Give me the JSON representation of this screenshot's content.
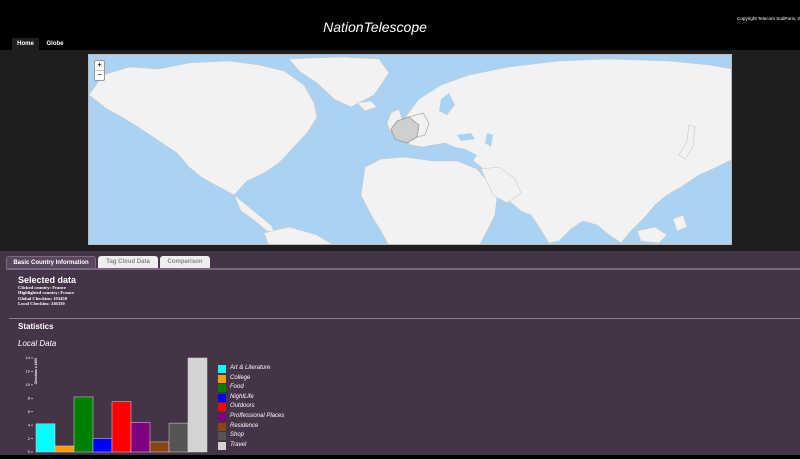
{
  "header": {
    "title": "NationTelescope",
    "copyright": "Copyright Telecom SudParis, 2"
  },
  "nav": {
    "home": "Home",
    "globe": "Globe"
  },
  "map": {
    "zoom_in": "+",
    "zoom_out": "−",
    "ocean_color": "#aad3f3",
    "land_color": "#f2f2f2",
    "highlight_color": "#cfcfcf"
  },
  "tabs": {
    "basic": "Basic Country Information",
    "tagcloud": "Tag Cloud Data",
    "comparison": "Comparison"
  },
  "selected": {
    "heading": "Selected data",
    "clicked": "Clicked country: France",
    "highlighted": "Highlighted country: France",
    "global_checkins": "Global Checkins: 193450",
    "local_checkins": "Local Checkins: 246350"
  },
  "statistics": {
    "heading": "Statistics",
    "subheading": "Local Data"
  },
  "chart_data": {
    "type": "bar",
    "ylabel": "Checkins x 1000",
    "ylim": [
      0,
      14
    ],
    "yticks": [
      "0",
      "2",
      "4",
      "6",
      "8",
      "10",
      "12",
      "14"
    ],
    "categories": [
      "Art & Literature",
      "College",
      "Food",
      "NightLife",
      "Outdoors",
      "Proffessional Places",
      "Residence",
      "Shop",
      "Travel"
    ],
    "values": [
      4.2,
      0.9,
      8.2,
      2.0,
      7.5,
      4.4,
      1.5,
      4.3,
      14.0
    ],
    "colors": [
      "#00ffff",
      "#ff9900",
      "#008000",
      "#0000ff",
      "#ff0000",
      "#800080",
      "#8b4513",
      "#555555",
      "#d3d3d3"
    ]
  }
}
